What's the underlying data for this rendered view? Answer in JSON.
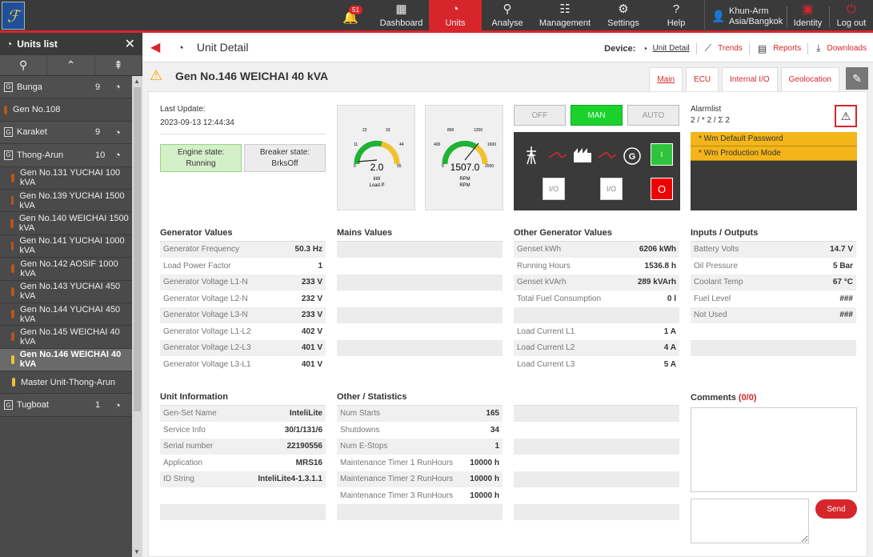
{
  "topbar": {
    "notifications": "51",
    "nav": [
      {
        "label": "Dashboard",
        "icon": "dashboard-icon"
      },
      {
        "label": "Units",
        "icon": "speedometer-icon"
      },
      {
        "label": "Analyse",
        "icon": "analyse-icon"
      },
      {
        "label": "Management",
        "icon": "management-icon"
      },
      {
        "label": "Settings",
        "icon": "gear-icon"
      },
      {
        "label": "Help",
        "icon": "help-icon"
      }
    ],
    "user_name": "Khun-Arm",
    "user_tz": "Asia/Bangkok",
    "identity": "Identity",
    "logout": "Log out"
  },
  "sidebar": {
    "title": "Units list",
    "items": [
      {
        "label": "Bunga",
        "count": "9",
        "type": "group"
      },
      {
        "label": "Gen No.108",
        "type": "plain"
      },
      {
        "label": "Karaket",
        "count": "9",
        "type": "group"
      },
      {
        "label": "Thong-Arun",
        "count": "10",
        "type": "group"
      },
      {
        "label": "Gen No.131 YUCHAI 100 kVA",
        "type": "unit"
      },
      {
        "label": "Gen No.139 YUCHAI 1500 kVA",
        "type": "unit"
      },
      {
        "label": "Gen No.140 WEICHAI 1500 kVA",
        "type": "unit"
      },
      {
        "label": "Gen No.141 YUCHAI 1000 kVA",
        "type": "unit"
      },
      {
        "label": "Gen No.142 AOSIF 1000 kVA",
        "type": "unit"
      },
      {
        "label": "Gen No.143 YUCHAI 450 kVA",
        "type": "unit"
      },
      {
        "label": "Gen No.144 YUCHAI 450 kVA",
        "type": "unit"
      },
      {
        "label": "Gen No.145 WEICHAI 40 kVA",
        "type": "unit"
      },
      {
        "label": "Gen No.146 WEICHAI 40 kVA",
        "type": "unit-selected"
      },
      {
        "label": "Master Unit-Thong-Arun",
        "type": "unit-yellow"
      },
      {
        "label": "Tugboat",
        "count": "1",
        "type": "group"
      }
    ]
  },
  "header": {
    "title": "Unit Detail",
    "device_label": "Device:",
    "unit_detail": "Unit Detail",
    "trends": "Trends",
    "reports": "Reports",
    "downloads": "Downloads"
  },
  "unit": {
    "name": "Gen No.146 WEICHAI 40 kVA",
    "tabs": [
      "Main",
      "ECU",
      "Internal I/O",
      "Geolocation"
    ]
  },
  "status": {
    "last_update_label": "Last Update:",
    "last_update": "2023-09-13 12:44:34",
    "engine_label": "Engine state:",
    "engine_value": "Running",
    "breaker_label": "Breaker state:",
    "breaker_value": "BrksOff"
  },
  "gauges": [
    {
      "value": "2.0",
      "unit": "kW",
      "name": "Load P",
      "ticks": [
        "0",
        "11",
        "22",
        "33",
        "44",
        "55"
      ]
    },
    {
      "value": "1507.0",
      "unit": "RPM",
      "name": "RPM",
      "ticks": [
        "0",
        "400",
        "800",
        "1200",
        "1600",
        "2000"
      ]
    }
  ],
  "control": {
    "modes": [
      "OFF",
      "MAN",
      "AUTO"
    ],
    "active_mode": "MAN",
    "io_label": "I/O",
    "on_label": "I",
    "off_label": "O"
  },
  "alarms": {
    "title": "Alarmlist",
    "summary": "2 / * 2 / Σ 2",
    "items": [
      "*   Wm Default Password",
      "*   Wm Production Mode"
    ]
  },
  "sections": {
    "generator": "Generator Values",
    "mains": "Mains Values",
    "other_gen": "Other Generator Values",
    "io": "Inputs / Outputs",
    "unit_info": "Unit Information",
    "stats": "Other / Statistics",
    "comments": "Comments",
    "comments_count": "(0/0)",
    "send": "Send"
  },
  "generator_values": [
    {
      "label": "Generator Frequency",
      "value": "50.3 Hz"
    },
    {
      "label": "Load Power Factor",
      "value": "1"
    },
    {
      "label": "Generator Voltage L1-N",
      "value": "233 V"
    },
    {
      "label": "Generator Voltage L2-N",
      "value": "232 V"
    },
    {
      "label": "Generator Voltage L3-N",
      "value": "233 V"
    },
    {
      "label": "Generator Voltage L1-L2",
      "value": "402 V"
    },
    {
      "label": "Generator Voltage L2-L3",
      "value": "401 V"
    },
    {
      "label": "Generator Voltage L3-L1",
      "value": "401 V"
    }
  ],
  "other_generator_values": [
    {
      "label": "Genset kWh",
      "value": "6206 kWh"
    },
    {
      "label": "Running Hours",
      "value": "1536.8 h"
    },
    {
      "label": "Genset kVArh",
      "value": "289 kVArh"
    },
    {
      "label": "Total Fuel Consumption",
      "value": "0 l"
    },
    {
      "label": "",
      "value": ""
    },
    {
      "label": "Load Current L1",
      "value": "1 A"
    },
    {
      "label": "Load Current L2",
      "value": "4 A"
    },
    {
      "label": "Load Current L3",
      "value": "5 A"
    }
  ],
  "inputs_outputs": [
    {
      "label": "Battery Volts",
      "value": "14.7 V"
    },
    {
      "label": "Oil Pressure",
      "value": "5 Bar"
    },
    {
      "label": "Coolant Temp",
      "value": "67 °C"
    },
    {
      "label": "Fuel Level",
      "value": "###"
    },
    {
      "label": "Not Used",
      "value": "###"
    }
  ],
  "unit_information": [
    {
      "label": "Gen-Set Name",
      "value": "InteliLite"
    },
    {
      "label": "Service Info",
      "value": "30/1/131/6"
    },
    {
      "label": "Serial number",
      "value": "22190556"
    },
    {
      "label": "Application",
      "value": "MRS16"
    },
    {
      "label": "ID String",
      "value": "InteliLite4-1.3.1.1"
    }
  ],
  "statistics": [
    {
      "label": "Num Starts",
      "value": "165"
    },
    {
      "label": "Shutdowns",
      "value": "34"
    },
    {
      "label": "Num E-Stops",
      "value": "1"
    },
    {
      "label": "Maintenance Timer 1 RunHours",
      "value": "10000 h"
    },
    {
      "label": "Maintenance Timer 2 RunHours",
      "value": "10000 h"
    },
    {
      "label": "Maintenance Timer 3 RunHours",
      "value": "10000 h"
    }
  ]
}
